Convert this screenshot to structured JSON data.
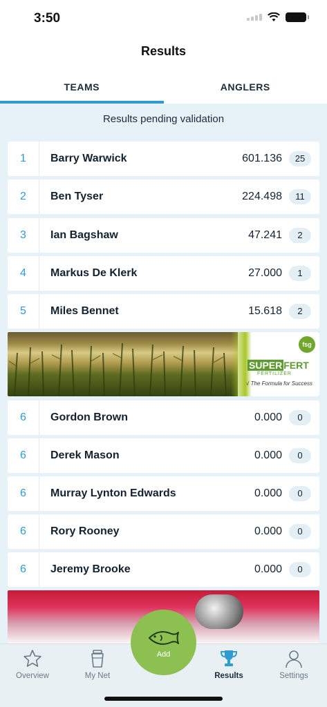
{
  "status_bar": {
    "time": "3:50"
  },
  "nav": {
    "title": "Results"
  },
  "tabs": [
    {
      "label": "TEAMS",
      "active": true
    },
    {
      "label": "ANGLERS",
      "active": false
    }
  ],
  "notice": "Results pending validation",
  "results_top": [
    {
      "rank": "1",
      "name": "Barry Warwick",
      "score": "601.136",
      "count": "25"
    },
    {
      "rank": "2",
      "name": "Ben Tyser",
      "score": "224.498",
      "count": "11"
    },
    {
      "rank": "3",
      "name": "Ian Bagshaw",
      "score": "47.241",
      "count": "2"
    },
    {
      "rank": "4",
      "name": "Markus De Klerk",
      "score": "27.000",
      "count": "1"
    },
    {
      "rank": "5",
      "name": "Miles Bennet",
      "score": "15.618",
      "count": "2"
    }
  ],
  "ad_superfert": {
    "brand_a": "SUPER",
    "brand_b": "FERT",
    "sub": "FERTILIZER",
    "tagline": "√ The Formula for Success",
    "badge": "fsg"
  },
  "results_bottom": [
    {
      "rank": "6",
      "name": "Gordon Brown",
      "score": "0.000",
      "count": "0"
    },
    {
      "rank": "6",
      "name": "Derek Mason",
      "score": "0.000",
      "count": "0"
    },
    {
      "rank": "6",
      "name": "Murray Lynton Edwards",
      "score": "0.000",
      "count": "0"
    },
    {
      "rank": "6",
      "name": "Rory Rooney",
      "score": "0.000",
      "count": "0"
    },
    {
      "rank": "6",
      "name": "Jeremy Brooke",
      "score": "0.000",
      "count": "0"
    }
  ],
  "tabbar": {
    "overview": "Overview",
    "my_net": "My Net",
    "add": "Add",
    "results": "Results",
    "settings": "Settings"
  },
  "colors": {
    "accent": "#2e9bd1",
    "add_button": "#8cc152",
    "background": "#e6f2f8"
  }
}
